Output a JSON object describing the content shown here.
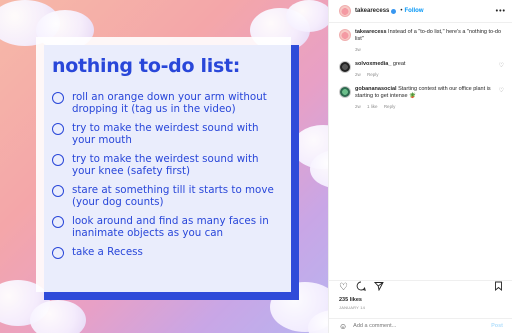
{
  "post_image": {
    "title": "nothing to-do list:",
    "items": [
      "roll an orange down your arm without dropping it (tag us in the video)",
      "try to make the weirdest sound with your mouth",
      "try to make the weirdest sound with your knee (safety first)",
      "stare at something till it starts to move (your dog counts)",
      "look around and find as many faces in inanimate objects as you can",
      "take a Recess"
    ]
  },
  "header": {
    "username": "takearecess",
    "separator": "•",
    "follow_label": "Follow",
    "more_label": "•••"
  },
  "caption": {
    "username": "takearecess",
    "text": "Instead of a \"to-do list,\" here's a \"nothing to-do list\"",
    "time": "3w"
  },
  "comments": [
    {
      "username": "solvoxmedia_",
      "text": "great",
      "time": "2w",
      "reply_label": "Reply"
    },
    {
      "username": "gobananasocial",
      "text": "Starting contest with our office plant is starting to get intense 🪴",
      "time": "2w",
      "likes": "1 like",
      "reply_label": "Reply"
    }
  ],
  "actions": {
    "like_icon": "heart-icon",
    "comment_icon": "comment-icon",
    "share_icon": "share-icon",
    "save_icon": "bookmark-icon"
  },
  "likes_text": "235 likes",
  "date_text": "JANUARY 14",
  "add_comment": {
    "placeholder": "Add a comment...",
    "post_label": "Post"
  }
}
